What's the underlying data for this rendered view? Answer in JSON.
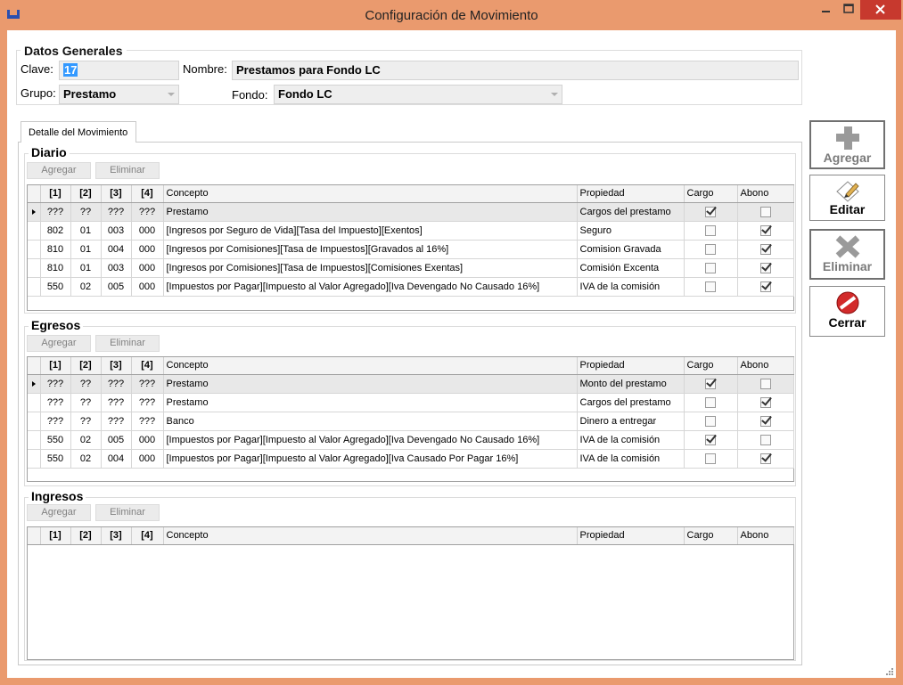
{
  "window": {
    "title": "Configuración de Movimiento"
  },
  "datos_generales": {
    "title": "Datos Generales",
    "clave_label": "Clave:",
    "clave_value": "17",
    "nombre_label": "Nombre:",
    "nombre_value": "Prestamos para Fondo LC",
    "grupo_label": "Grupo:",
    "grupo_value": "Prestamo",
    "fondo_label": "Fondo:",
    "fondo_value": "Fondo LC"
  },
  "tab": {
    "label": "Detalle del Movimiento"
  },
  "grid_headers": [
    "[1]",
    "[2]",
    "[3]",
    "[4]",
    "Concepto",
    "Propiedad",
    "Cargo",
    "Abono"
  ],
  "buttons": {
    "agregar": "Agregar",
    "eliminar": "Eliminar"
  },
  "diario": {
    "title": "Diario",
    "rows": [
      {
        "c1": "???",
        "c2": "??",
        "c3": "???",
        "c4": "???",
        "concepto": "Prestamo",
        "propiedad": "Cargos del prestamo",
        "cargo": true,
        "abono": false,
        "current": true
      },
      {
        "c1": "802",
        "c2": "01",
        "c3": "003",
        "c4": "000",
        "concepto": "[Ingresos por Seguro de Vida][Tasa del Impuesto][Exentos]",
        "propiedad": "Seguro",
        "cargo": false,
        "abono": true,
        "current": false
      },
      {
        "c1": "810",
        "c2": "01",
        "c3": "004",
        "c4": "000",
        "concepto": "[Ingresos por Comisiones][Tasa de Impuestos][Gravados al 16%]",
        "propiedad": "Comision Gravada",
        "cargo": false,
        "abono": true,
        "current": false
      },
      {
        "c1": "810",
        "c2": "01",
        "c3": "003",
        "c4": "000",
        "concepto": "[Ingresos por Comisiones][Tasa de Impuestos][Comisiones Exentas]",
        "propiedad": "Comisión Excenta",
        "cargo": false,
        "abono": true,
        "current": false
      },
      {
        "c1": "550",
        "c2": "02",
        "c3": "005",
        "c4": "000",
        "concepto": "[Impuestos por Pagar][Impuesto al Valor Agregado][Iva Devengado No Causado 16%]",
        "propiedad": "IVA de la comisión",
        "cargo": false,
        "abono": true,
        "current": false
      }
    ]
  },
  "egresos": {
    "title": "Egresos",
    "rows": [
      {
        "c1": "???",
        "c2": "??",
        "c3": "???",
        "c4": "???",
        "concepto": "Prestamo",
        "propiedad": "Monto del prestamo",
        "cargo": true,
        "abono": false,
        "current": true
      },
      {
        "c1": "???",
        "c2": "??",
        "c3": "???",
        "c4": "???",
        "concepto": "Prestamo",
        "propiedad": "Cargos del prestamo",
        "cargo": false,
        "abono": true,
        "current": false
      },
      {
        "c1": "???",
        "c2": "??",
        "c3": "???",
        "c4": "???",
        "concepto": "Banco",
        "propiedad": "Dinero a entregar",
        "cargo": false,
        "abono": true,
        "current": false
      },
      {
        "c1": "550",
        "c2": "02",
        "c3": "005",
        "c4": "000",
        "concepto": "[Impuestos por Pagar][Impuesto al Valor Agregado][Iva Devengado No Causado 16%]",
        "propiedad": "IVA de la comisión",
        "cargo": true,
        "abono": false,
        "current": false
      },
      {
        "c1": "550",
        "c2": "02",
        "c3": "004",
        "c4": "000",
        "concepto": "[Impuestos por Pagar][Impuesto al Valor Agregado][Iva Causado Por Pagar  16%]",
        "propiedad": "IVA de la comisión",
        "cargo": false,
        "abono": true,
        "current": false
      }
    ]
  },
  "ingresos": {
    "title": "Ingresos",
    "rows": []
  },
  "side_buttons": {
    "agregar": "Agregar",
    "editar": "Editar",
    "eliminar": "Eliminar",
    "cerrar": "Cerrar"
  }
}
